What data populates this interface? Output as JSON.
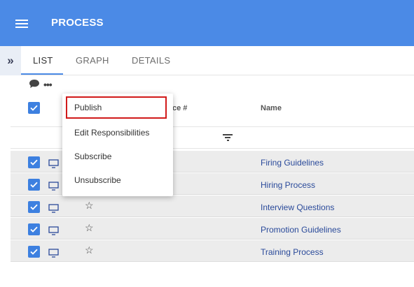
{
  "header": {
    "title": "PROCESS"
  },
  "tabs": [
    {
      "label": "LIST",
      "active": true
    },
    {
      "label": "GRAPH",
      "active": false
    },
    {
      "label": "DETAILS",
      "active": false
    }
  ],
  "toolbar": {
    "more_label": "•••"
  },
  "expand_label": "»",
  "columns": {
    "reference": "ce #",
    "name": "Name"
  },
  "context_menu": {
    "items": [
      "Publish",
      "Edit Responsibilities",
      "Subscribe",
      "Unsubscribe"
    ],
    "highlighted": "Publish",
    "highlight_color": "#d11a1a"
  },
  "rows": [
    {
      "name": "Firing Guidelines",
      "checked": true
    },
    {
      "name": "Hiring Process",
      "checked": true
    },
    {
      "name": "Interview Questions",
      "checked": true
    },
    {
      "name": "Promotion Guidelines",
      "checked": true
    },
    {
      "name": "Training Process",
      "checked": true
    }
  ],
  "colors": {
    "primary": "#4b8ae6",
    "checkbox": "#3d80e0",
    "link": "#2a4a9a",
    "row_bg": "#ececec"
  },
  "icons": [
    "menu-icon",
    "chevrons-right-icon",
    "comment-icon",
    "more-icon",
    "checkbox-icon",
    "monitor-icon",
    "star-icon",
    "filter-icon"
  ]
}
